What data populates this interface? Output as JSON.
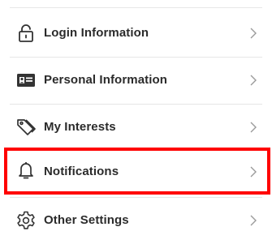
{
  "menu": {
    "items": [
      {
        "label": "Login Information",
        "icon": "lock-icon",
        "chevron": "chevron-right-icon"
      },
      {
        "label": "Personal Information",
        "icon": "id-card-icon",
        "chevron": "chevron-right-icon"
      },
      {
        "label": "My Interests",
        "icon": "tags-icon",
        "chevron": "chevron-right-icon"
      },
      {
        "label": "Notifications",
        "icon": "bell-icon",
        "chevron": "chevron-right-icon"
      },
      {
        "label": "Other Settings",
        "icon": "gear-icon",
        "chevron": "chevron-right-icon"
      }
    ],
    "highlighted_item": "Notifications"
  },
  "colors": {
    "text": "#2b2b2b",
    "icon": "#333333",
    "chevron": "#9a9a9a",
    "divider": "#e6e6e6",
    "highlight": "#ff0000"
  }
}
